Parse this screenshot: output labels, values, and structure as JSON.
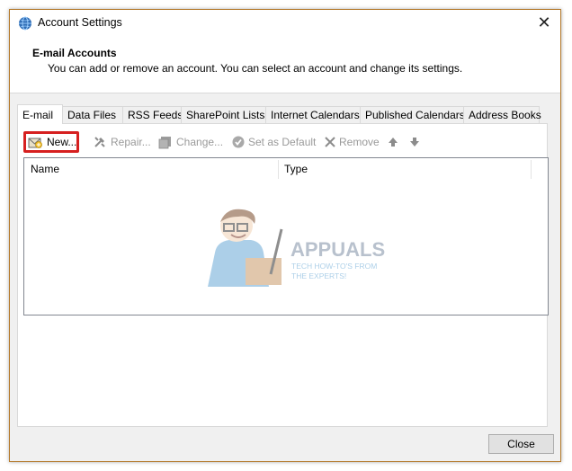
{
  "window": {
    "title": "Account Settings",
    "close_glyph": "✕"
  },
  "header": {
    "title": "E-mail Accounts",
    "subtitle": "You can add or remove an account. You can select an account and change its settings."
  },
  "tabs": [
    {
      "label": "E-mail",
      "active": true
    },
    {
      "label": "Data Files"
    },
    {
      "label": "RSS Feeds"
    },
    {
      "label": "SharePoint Lists"
    },
    {
      "label": "Internet Calendars"
    },
    {
      "label": "Published Calendars"
    },
    {
      "label": "Address Books"
    }
  ],
  "toolbar": {
    "new_label": "New...",
    "repair_label": "Repair...",
    "change_label": "Change...",
    "default_label": "Set as Default",
    "remove_label": "Remove",
    "up_icon": "up-arrow-icon",
    "down_icon": "down-arrow-icon",
    "highlight_color": "#d62020"
  },
  "list": {
    "columns": [
      "Name",
      "Type"
    ]
  },
  "watermark": {
    "brand": "APPUALS",
    "line1": "TECH HOW-TO'S FROM",
    "line2": "THE EXPERTS!"
  },
  "footer": {
    "close_label": "Close"
  }
}
